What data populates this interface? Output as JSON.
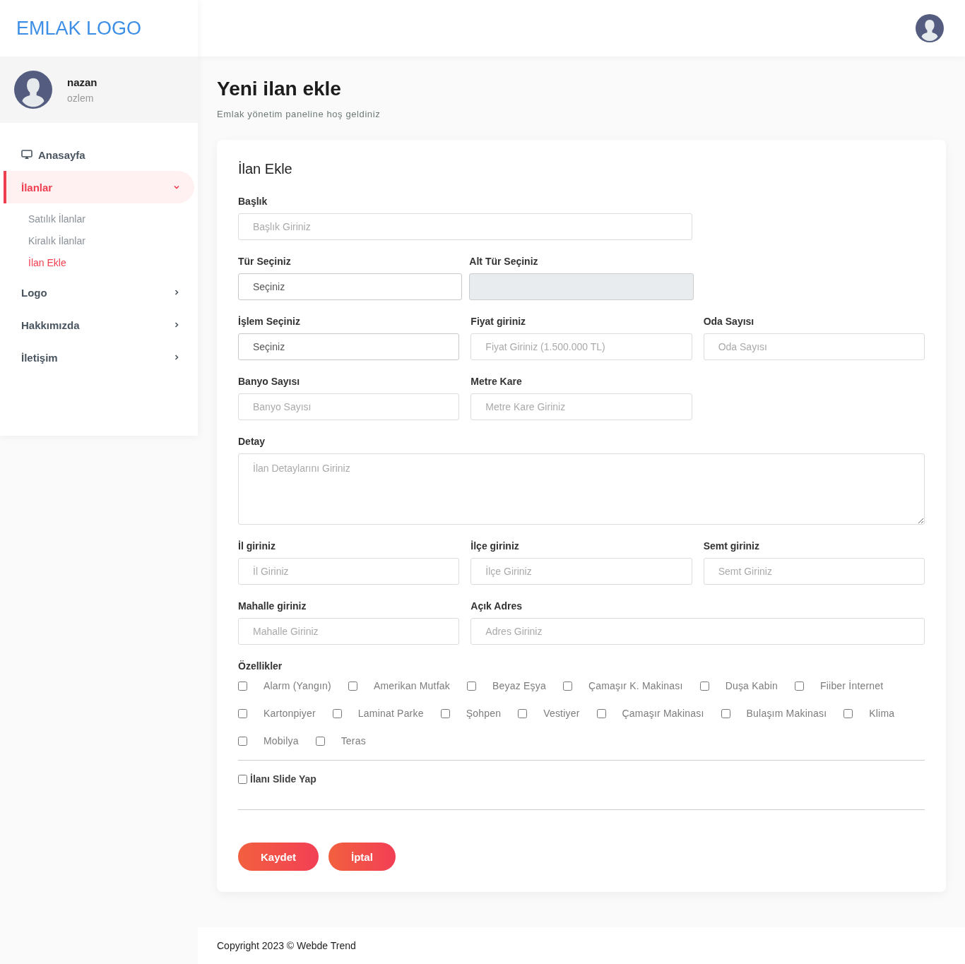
{
  "brand": "EMLAK LOGO",
  "user": {
    "name": "nazan",
    "role": "ozlem"
  },
  "nav": [
    {
      "label": "Anasayfa",
      "selected": false
    },
    {
      "label": "İlanlar",
      "selected": true,
      "expanded": true,
      "children": [
        {
          "label": "Satılık İlanlar",
          "selected": false
        },
        {
          "label": "Kiralık İlanlar",
          "selected": false
        },
        {
          "label": "İlan Ekle",
          "selected": true
        }
      ]
    },
    {
      "label": "Logo",
      "selected": false,
      "expanded": false
    },
    {
      "label": "Hakkımızda",
      "selected": false,
      "expanded": false
    },
    {
      "label": "İletişim",
      "selected": false,
      "expanded": false
    }
  ],
  "page": {
    "title": "Yeni ilan ekle",
    "subtitle": "Emlak yönetim paneline hoş geldiniz"
  },
  "form": {
    "title": "İlan Ekle",
    "rows": [
      [
        {
          "label": "Başlık",
          "kind": "text",
          "placeholder": "Başlık Giriniz",
          "wide": true
        }
      ],
      [
        {
          "label": "Tür Seçiniz",
          "kind": "select",
          "value": "Seçiniz"
        },
        {
          "label": "Alt Tür Seçiniz",
          "kind": "disabled-select"
        }
      ],
      [
        {
          "label": "İşlem Seçiniz",
          "kind": "select",
          "value": "Seçiniz"
        },
        {
          "label": "Fiyat giriniz",
          "kind": "text",
          "placeholder": "Fiyat Giriniz (1.500.000 TL)"
        },
        {
          "label": "Oda Sayısı",
          "kind": "text",
          "placeholder": "Oda Sayısı"
        }
      ],
      [
        {
          "label": "Banyo Sayısı",
          "kind": "text",
          "placeholder": "Banyo Sayısı"
        },
        {
          "label": "Metre Kare",
          "kind": "text",
          "placeholder": "Metre Kare Giriniz"
        }
      ],
      [
        {
          "label": "Detay",
          "kind": "textarea",
          "placeholder": "İlan Detaylarını Giriniz"
        }
      ],
      [
        {
          "label": "İl giriniz",
          "kind": "text",
          "placeholder": "İl Giriniz"
        },
        {
          "label": "İlçe giriniz",
          "kind": "text",
          "placeholder": "İlçe Giriniz"
        },
        {
          "label": "Semt giriniz",
          "kind": "text",
          "placeholder": "Semt Giriniz"
        }
      ],
      [
        {
          "label": "Mahalle giriniz",
          "kind": "text",
          "placeholder": "Mahalle Giriniz"
        },
        {
          "label": "Açık Adres",
          "kind": "text",
          "placeholder": "Adres Giriniz",
          "wide": true
        }
      ]
    ],
    "features_title": "Özellikler",
    "features": [
      [
        {
          "label": "Alarm (Yangın)",
          "checked": false
        },
        {
          "label": "Amerikan Mutfak",
          "checked": false
        },
        {
          "label": "Beyaz Eşya",
          "checked": false
        },
        {
          "label": "Çamaşır K. Makinası",
          "checked": false
        },
        {
          "label": "Duşa Kabin",
          "checked": false
        },
        {
          "label": "Fiiber İnternet",
          "checked": false
        }
      ],
      [
        {
          "label": "Kartonpiyer",
          "checked": false
        },
        {
          "label": "Laminat Parke",
          "checked": false
        },
        {
          "label": "Şohpen",
          "checked": false
        },
        {
          "label": "Vestiyer",
          "checked": false
        },
        {
          "label": "Çamaşır Makinası",
          "checked": false
        },
        {
          "label": "Bulaşım Makinası",
          "checked": false
        },
        {
          "label": "Klima",
          "checked": false
        }
      ],
      [
        {
          "label": "Mobilya",
          "checked": false
        },
        {
          "label": "Teras",
          "checked": false
        }
      ]
    ],
    "slide": {
      "label": "İlanı Slide Yap",
      "checked": false
    },
    "buttons": [
      "Kaydet",
      "İptal"
    ]
  },
  "footer": "Copyright 2023 © Webde Trend"
}
